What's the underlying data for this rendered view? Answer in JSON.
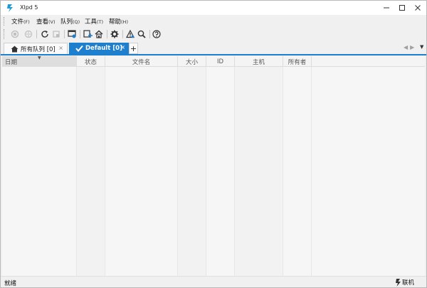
{
  "window": {
    "title": "Xlpd 5"
  },
  "menubar": {
    "items": [
      {
        "label": "文件",
        "key": "(F)"
      },
      {
        "label": "查看",
        "key": "(V)"
      },
      {
        "label": "队列",
        "key": "(Q)"
      },
      {
        "label": "工具",
        "key": "(T)"
      },
      {
        "label": "帮助",
        "key": "(H)"
      }
    ]
  },
  "toolbar": {
    "icons": [
      "print-icon",
      "printer-settings-icon",
      "refresh-icon",
      "stop-icon",
      "queue-view-icon",
      "add-queue-icon",
      "home-icon",
      "settings-icon",
      "alert-icon",
      "search-icon",
      "help-icon"
    ]
  },
  "tabs": {
    "all": {
      "label": "所有队列 [0]",
      "close": "×"
    },
    "default": {
      "label": "Default [0]",
      "close": "×"
    },
    "add": "+"
  },
  "table": {
    "columns": [
      "日期",
      "状态",
      "文件名",
      "大小",
      "ID",
      "主机",
      "所有者"
    ],
    "rows": []
  },
  "status": {
    "text": "就绪",
    "online": "联机"
  },
  "colors": {
    "accent": "#1e7fcf",
    "background": "#f0f0f0"
  }
}
